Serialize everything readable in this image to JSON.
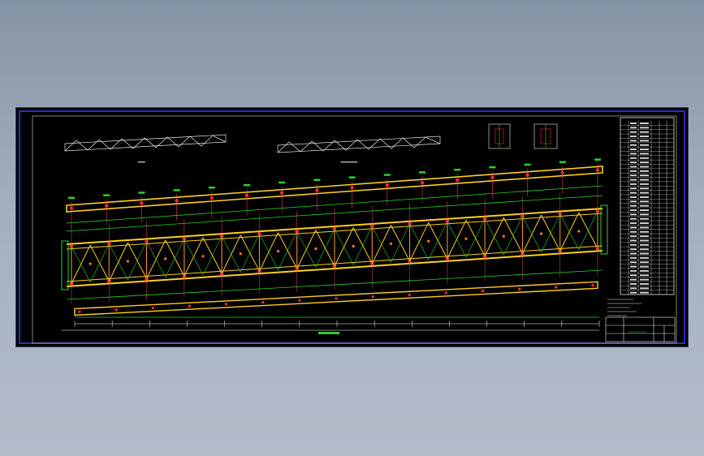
{
  "drawing": {
    "background": "#000000",
    "colors": {
      "frame": "#3b3bff",
      "chord": "#ffcf1f",
      "member": "#2bd12b",
      "node": "#ff2a2a",
      "dimension": "#ffffff",
      "table_line": "#ffffff"
    },
    "panel_count": 14,
    "table_rows": 40
  }
}
